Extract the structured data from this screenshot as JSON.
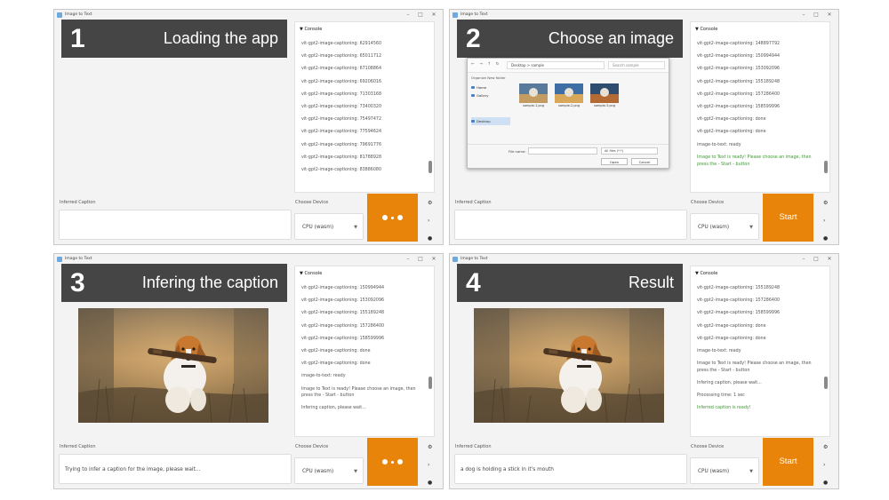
{
  "panels": [
    {
      "window_title": "Image to Text",
      "step_number": "1",
      "step_title": "Loading the app",
      "console_header": "Console",
      "console_lines": [
        "vit-gpt2-image-captioning: 62914560",
        "vit-gpt2-image-captioning: 65011712",
        "vit-gpt2-image-captioning: 67108864",
        "vit-gpt2-image-captioning: 69206016",
        "vit-gpt2-image-captioning: 71303168",
        "vit-gpt2-image-captioning: 73400320",
        "vit-gpt2-image-captioning: 75497472",
        "vit-gpt2-image-captioning: 77594624",
        "vit-gpt2-image-captioning: 79691776",
        "vit-gpt2-image-captioning: 81788928",
        "vit-gpt2-image-captioning: 83886080"
      ],
      "caption_label": "Inferred Caption",
      "caption_value": "",
      "device_label": "Choose Device",
      "device_value": "CPU (wasm)",
      "button_label": "",
      "button_state": "loading"
    },
    {
      "window_title": "Image to Text",
      "step_number": "2",
      "step_title": "Choose an image",
      "console_header": "Console",
      "console_lines": [
        "vit-gpt2-image-captioning: 148897792",
        "vit-gpt2-image-captioning: 150994944",
        "vit-gpt2-image-captioning: 153092096",
        "vit-gpt2-image-captioning: 155189248",
        "vit-gpt2-image-captioning: 157286400",
        "vit-gpt2-image-captioning: 158599996",
        "vit-gpt2-image-captioning: done",
        "vit-gpt2-image-captioning: done",
        "image-to-text: ready",
        "Image to Text is ready! Please choose an image, then press the - Start - button"
      ],
      "caption_label": "Inferred Caption",
      "caption_value": "",
      "device_label": "Choose Device",
      "device_value": "CPU (wasm)",
      "button_label": "Start",
      "button_state": "ready",
      "dialog": {
        "path": "Desktop > sample",
        "search_placeholder": "Search sample",
        "toolbar_organize": "Organize",
        "toolbar_new_folder": "New folder",
        "sidebar": [
          "Home",
          "Gallery",
          "Desktop"
        ],
        "files": [
          "sample-1.png",
          "sample-2.png",
          "sample-3.png"
        ],
        "filename_label": "File name:",
        "filetype": "All files (*.*)",
        "open_label": "Open",
        "cancel_label": "Cancel"
      }
    },
    {
      "window_title": "Image to Text",
      "step_number": "3",
      "step_title": "Infering the caption",
      "console_header": "Console",
      "console_lines": [
        "vit-gpt2-image-captioning: 150994944",
        "vit-gpt2-image-captioning: 153092096",
        "vit-gpt2-image-captioning: 155189248",
        "vit-gpt2-image-captioning: 157286400",
        "vit-gpt2-image-captioning: 158599996",
        "vit-gpt2-image-captioning: done",
        "vit-gpt2-image-captioning: done",
        "image-to-text: ready",
        "Image to Text is ready! Please choose an image, then press the - Start - button",
        "Infering caption, please wait..."
      ],
      "caption_label": "Inferred Caption",
      "caption_value": "Trying to infer a caption for the image, please wait...",
      "device_label": "Choose Device",
      "device_value": "CPU (wasm)",
      "button_label": "",
      "button_state": "loading"
    },
    {
      "window_title": "Image to Text",
      "step_number": "4",
      "step_title": "Result",
      "console_header": "Console",
      "console_lines": [
        "vit-gpt2-image-captioning: 155189248",
        "vit-gpt2-image-captioning: 157286400",
        "vit-gpt2-image-captioning: 158599996",
        "vit-gpt2-image-captioning: done",
        "vit-gpt2-image-captioning: done",
        "image-to-text: ready",
        "Image to Text is ready! Please choose an image, then press the - Start - button",
        "Infering caption, please wait...",
        "Processing time: 1 sec",
        "Inferred caption is ready!"
      ],
      "caption_label": "Inferred Caption",
      "caption_value": "a dog is holding a stick in it's mouth",
      "device_label": "Choose Device",
      "device_value": "CPU (wasm)",
      "button_label": "Start",
      "button_state": "ready"
    }
  ],
  "colors": {
    "accent": "#e8840a",
    "banner": "#454545",
    "success": "#3a9a2e"
  },
  "icons": {
    "window_minimize": "minimize-icon",
    "window_maximize": "maximize-icon",
    "window_close": "close-icon",
    "console_toggle": "triangle-down-icon",
    "device_dropdown": "chevron-down-icon",
    "side_controls": [
      "settings-icon",
      "expand-icon",
      "info-icon"
    ]
  }
}
